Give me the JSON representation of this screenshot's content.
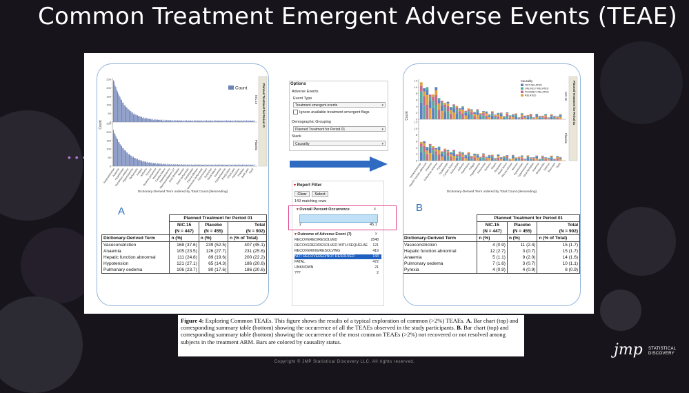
{
  "slide": {
    "title": "Common Treatment Emergent Adverse Events (TEAE)",
    "copyright": "Copyright © JMP Statistical Discovery LLC. All rights reserved.",
    "logo": {
      "mark": "jmp",
      "line1": "STATISTICAL",
      "line2": "DISCOVERY"
    }
  },
  "panelA": {
    "letter": "A",
    "y_axis_label": "Count",
    "x_axis_label": "Dictionary-Derived Term ordered by Total Count (descending)",
    "legend_label": "Count",
    "group_header": "Planned Treatment for Period 01",
    "groups": [
      "NIC.15",
      "Placebo"
    ],
    "y_ticks": [
      "250",
      "200",
      "150",
      "100",
      "50",
      "0"
    ],
    "x_tick_labels": [
      "Vasoconstriction",
      "Anaemia",
      "Hypotension",
      "Pulmonary oedema",
      "Hyperkalaemia",
      "Tachycardia",
      "Fatigue",
      "Asthenia",
      "Pyrexia",
      "Oedema peripheral",
      "Haematuria",
      "Cardiac failure",
      "Hyponatraemia",
      "Electrocardiogram QT",
      "Atrial fibrillation",
      "Nausea",
      "Sinus tachycardia",
      "Constipation",
      "Pleural effusion",
      "Ventricular tachycardia",
      "Hypertension",
      "Dyspnoea",
      "Renal failure",
      "Insomnia",
      "Hypocalcaemia",
      "Bradycardia",
      "Chest pain",
      "Headache",
      "Phlebitis",
      "Back pain",
      "Rash"
    ],
    "table": {
      "title": "Planned Treatment for Period 01",
      "columns": [
        {
          "name": "NIC.15",
          "n": "(N = 447)"
        },
        {
          "name": "Placebo",
          "n": "(N = 455)"
        },
        {
          "name": "Total",
          "n": "(N = 902)"
        }
      ],
      "row_header": "Dictionary-Derived Term",
      "measures": [
        "n (%)",
        "n (%)",
        "n (% of Total)"
      ],
      "rows": [
        {
          "term": "Vasoconstriction",
          "values": [
            "168 (37.6)",
            "239 (52.5)",
            "407 (45.1)"
          ]
        },
        {
          "term": "Anaemia",
          "values": [
            "105 (23.5)",
            "126 (27.7)",
            "231 (25.6)"
          ]
        },
        {
          "term": "Hepatic function abnormal",
          "values": [
            "111 (24.8)",
            "89 (19.6)",
            "200 (22.2)"
          ]
        },
        {
          "term": "Hypotension",
          "values": [
            "121 (27.1)",
            "65 (14.3)",
            "186 (20.6)"
          ]
        },
        {
          "term": "Pulmonary oedema",
          "values": [
            "106 (23.7)",
            "80 (17.6)",
            "186 (20.6)"
          ]
        }
      ]
    }
  },
  "options": {
    "title": "Options",
    "adverse_events_label": "Adverse Events",
    "event_type_label": "Event Type",
    "event_type_value": "Treatment emergent events",
    "ignore_flags_label": "Ignore available treatment emergent flags",
    "demographic_label": "Demographic Grouping",
    "demographic_value": "Planned Treatment for Period 01",
    "stack_label": "Stack",
    "stack_value": "Causality"
  },
  "report_filter": {
    "title": "Report Filter",
    "clear_label": "Clear",
    "select_label": "Select",
    "matching_rows": "143 matching rows",
    "percent_filter_title": "Overall Percent Occurrence",
    "percent_min": "2",
    "percent_max": "45.1",
    "outcome_title": "Outcome of Adverse Event (7)",
    "outcomes": [
      {
        "label": "RECOVERED/RESOLVED",
        "count": "2548",
        "selected": false
      },
      {
        "label": "RECOVERED/RESOLVED WITH SEQUELAE",
        "count": "121",
        "selected": false
      },
      {
        "label": "RECOVERING/RESOLVING",
        "count": "419",
        "selected": false
      },
      {
        "label": "NOT RECOVERED/NOT RESOLVED",
        "count": "143",
        "selected": true
      },
      {
        "label": "FATAL",
        "count": "472",
        "selected": false
      },
      {
        "label": "UNKNOWN",
        "count": "21",
        "selected": false
      },
      {
        "label": "???",
        "count": "2",
        "selected": false
      }
    ]
  },
  "panelB": {
    "letter": "B",
    "y_axis_label": "Count",
    "x_axis_label": "Dictionary-Derived Term ordered by Total Count (descending)",
    "legend_title": "Causality",
    "legend": [
      {
        "label": "NOT RELATED",
        "color": "#5b7fbf"
      },
      {
        "label": "UNLIKELY RELATED",
        "color": "#5aa8a0"
      },
      {
        "label": "POSSIBLY RELATED",
        "color": "#c46d8a"
      },
      {
        "label": "RELATED",
        "color": "#e0a040"
      }
    ],
    "group_header": "Planned Treatment for Period 01",
    "groups": [
      "NIC.15",
      "Placebo"
    ],
    "y_ticks": [
      "12",
      "10",
      "8",
      "6",
      "4",
      "2",
      "0"
    ],
    "x_tick_labels": [
      "Vasoconstriction",
      "Hepatic function abnormal",
      "Anaemia",
      "Pulmonary oedema",
      "Pyrexia",
      "Hypotension",
      "Cardiac failure",
      "Tachycardia",
      "Asthenia",
      "Haematuria",
      "Fatigue",
      "Hypokalaemia",
      "Pneumonia",
      "Oedema",
      "Sepsis",
      "Dyspnoea",
      "Renal failure",
      "Pleural effusion",
      "Nausea",
      "Hypertension",
      "Hyponatraemia",
      "Atrial fibrillation",
      "Insomnia",
      "Bradycardia",
      "Delirium",
      "Back pain",
      "Rash"
    ],
    "table": {
      "title": "Planned Treatment for Period 01",
      "columns": [
        {
          "name": "NIC.15",
          "n": "(N = 447)"
        },
        {
          "name": "Placebo",
          "n": "(N = 455)"
        },
        {
          "name": "Total",
          "n": "(N = 902)"
        }
      ],
      "row_header": "Dictionary-Derived Term",
      "measures": [
        "n (%)",
        "n (%)",
        "n (% of Total)"
      ],
      "rows": [
        {
          "term": "Vasoconstriction",
          "values": [
            "4 (0.9)",
            "11 (2.4)",
            "15 (1.7)"
          ]
        },
        {
          "term": "Hepatic function abnormal",
          "values": [
            "12 (2.7)",
            "3 (0.7)",
            "15 (1.7)"
          ]
        },
        {
          "term": "Anaemia",
          "values": [
            "5 (1.1)",
            "9 (2.0)",
            "14 (1.6)"
          ]
        },
        {
          "term": "Pulmonary oedema",
          "values": [
            "7 (1.6)",
            "3 (0.7)",
            "10 (1.1)"
          ]
        },
        {
          "term": "Pyrexia",
          "values": [
            "4 (0.9)",
            "4 (0.9)",
            "8 (0.9)"
          ]
        }
      ]
    }
  },
  "caption": {
    "figure_label": "Figure 4:",
    "intro": "Exploring Common TEAEs. This figure shows the results of a typical exploration of common (>2%) TEAEs.",
    "a_label": "A.",
    "a_text": "Bar chart (top) and corresponding summary table (bottom) showing the occurrence of all the TEAEs observed in the study participants.",
    "b_label": "B.",
    "b_text": "Bar chart (top) and corresponding summary table (bottom) showing the occurrence of the most common TEAEs (>2%) not recovered or not resolved among subjects in the treatment ARM. Bars are colored by causality status."
  }
}
